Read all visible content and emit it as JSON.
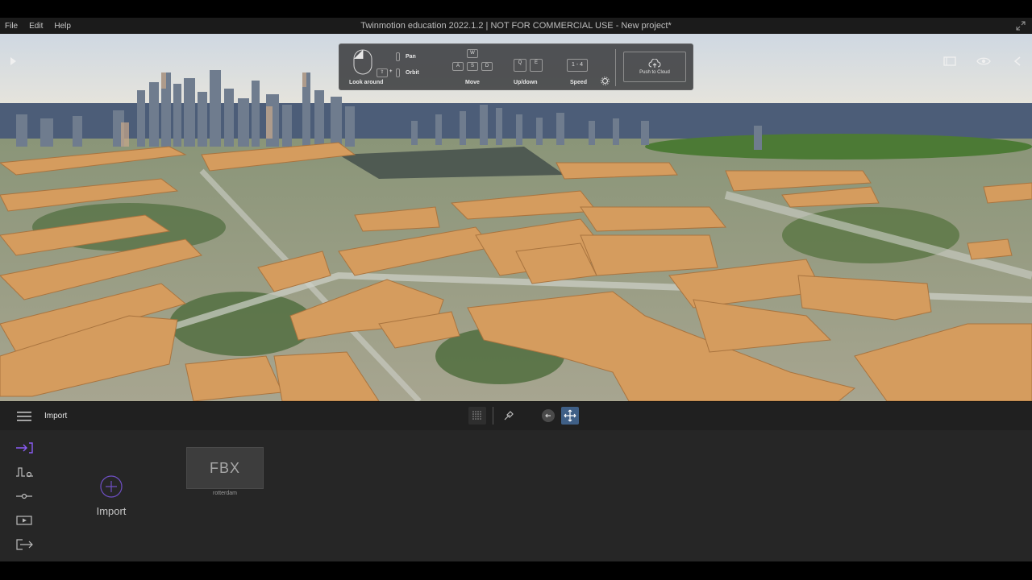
{
  "menu": {
    "file": "File",
    "edit": "Edit",
    "help": "Help"
  },
  "window": {
    "title": "Twinmotion education 2022.1.2 | NOT FOR COMMERCIAL USE - New project*"
  },
  "hud": {
    "look_label": "Look around",
    "pan_label": "Pan",
    "orbit_label": "Orbit",
    "move_label": "Move",
    "updown_label": "Up/down",
    "speed_label": "Speed",
    "speed_value": "1 - 4",
    "push_label": "Push to Cloud",
    "keys": {
      "w": "W",
      "a": "A",
      "s": "S",
      "d": "D",
      "q": "Q",
      "e": "E"
    }
  },
  "toolbar": {
    "title": "Import"
  },
  "panel": {
    "import_label": "Import",
    "fbx_label": "FBX",
    "fbx_name": "rotterdam"
  },
  "colors": {
    "accent": "#8b5cf6",
    "active_tool": "#3f5f86",
    "building": "#d59c5e",
    "sky": "#dde4ec"
  }
}
